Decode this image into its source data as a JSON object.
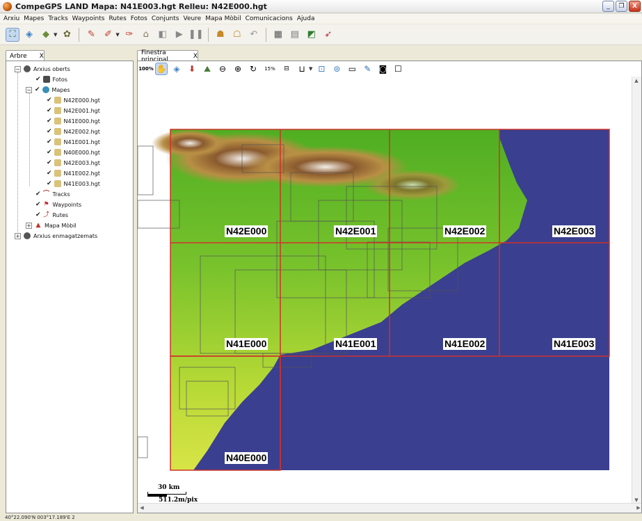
{
  "window": {
    "title": "CompeGPS LAND Mapa: N41E003.hgt Relleu: N42E000.hgt",
    "minimize": "_",
    "maximize": "❐",
    "close": "X"
  },
  "menu": [
    "Arxiu",
    "Mapes",
    "Tracks",
    "Waypoints",
    "Rutes",
    "Fotos",
    "Conjunts",
    "Veure",
    "Mapa Mòbil",
    "Comunicacions",
    "Ajuda"
  ],
  "left_panel": {
    "tab_label": "Arbre",
    "tab_close": "X",
    "tree": {
      "open_files": "Arxius oberts",
      "photos": "Fotos",
      "maps": "Mapes",
      "map_files": [
        "N42E000.hgt",
        "N42E001.hgt",
        "N41E000.hgt",
        "N42E002.hgt",
        "N41E001.hgt",
        "N40E000.hgt",
        "N42E003.hgt",
        "N41E002.hgt",
        "N41E003.hgt"
      ],
      "tracks": "Tracks",
      "waypoints": "Waypoints",
      "routes": "Rutes",
      "mobile_map": "Mapa Mòbil",
      "stored_files": "Arxius enmagatzemats"
    }
  },
  "map_window": {
    "tab_label": "Finestra principal",
    "tab_close": "X",
    "zoom_label": "15%",
    "tile_labels": [
      "N42E000",
      "N42E001",
      "N42E002",
      "N42E003",
      "N41E000",
      "N41E001",
      "N41E002",
      "N41E003",
      "N40E000"
    ],
    "scale": {
      "distance": "30 km",
      "resolution": "511.2m/pix"
    }
  },
  "status": {
    "coords": "40°22.090'N 003°17.189'E 2"
  },
  "colors": {
    "sea": "#3a3f8f",
    "grid": "#d0302a",
    "lowland": "#5dbb28",
    "mountain": "#8a5a2e"
  }
}
